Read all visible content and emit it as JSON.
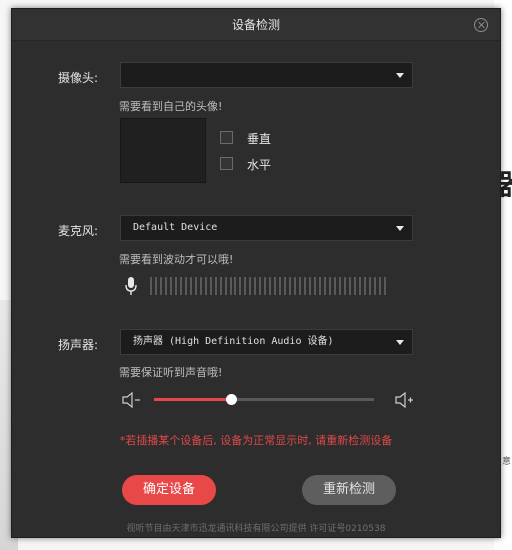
{
  "dialog": {
    "title": "设备检测"
  },
  "camera": {
    "label": "摄像头:",
    "selected": "",
    "hint": "需要看到自己的头像!",
    "flip_vertical_label": "垂直",
    "flip_horizontal_label": "水平"
  },
  "microphone": {
    "label": "麦克风:",
    "selected": "Default Device",
    "hint": "需要看到波动才可以哦!",
    "level": 0
  },
  "speaker": {
    "label": "扬声器:",
    "selected": "扬声器 (High Definition Audio 设备)",
    "hint": "需要保证听到声音哦!",
    "volume_percent": 35
  },
  "warning": "*若插播某个设备后, 设备为正常显示时, 请重新检测设备",
  "buttons": {
    "confirm": "确定设备",
    "recheck": "重新检测"
  },
  "footer": "视听节目由天津市迅龙通讯科技有限公司提供 许可证号0210538",
  "background": {
    "right_glyph": "器",
    "right_small": "意"
  },
  "colors": {
    "dialog_bg": "#2d2d2d",
    "accent": "#e84848",
    "warning": "#e04848"
  }
}
